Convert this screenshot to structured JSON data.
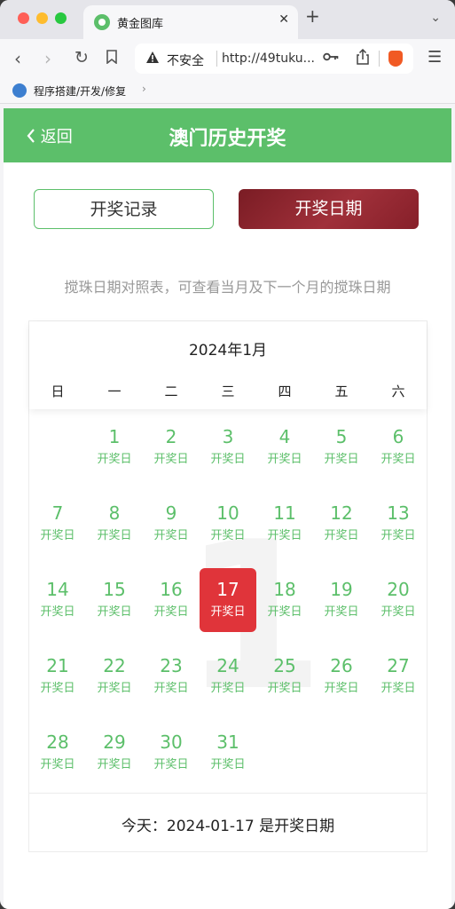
{
  "browser": {
    "tab_title": "黄金图库",
    "close_glyph": "✕",
    "new_tab_glyph": "+",
    "menu_glyph": "⌄",
    "security_label": "不安全",
    "url": "http://49tuku...",
    "bookmark_label": "程序搭建/开发/修复"
  },
  "header": {
    "back_label": "返回",
    "title": "澳门历史开奖"
  },
  "buttons": {
    "records": "开奖记录",
    "dates": "开奖日期"
  },
  "description": "搅珠日期对照表，可查看当月及下一个月的搅珠日期",
  "calendar": {
    "month_label": "2024年1月",
    "watermark": "1",
    "weekdays": [
      "日",
      "一",
      "二",
      "三",
      "四",
      "五",
      "六"
    ],
    "first_weekday": 1,
    "days": [
      {
        "num": "1",
        "label": "开奖日"
      },
      {
        "num": "2",
        "label": "开奖日"
      },
      {
        "num": "3",
        "label": "开奖日"
      },
      {
        "num": "4",
        "label": "开奖日"
      },
      {
        "num": "5",
        "label": "开奖日"
      },
      {
        "num": "6",
        "label": "开奖日"
      },
      {
        "num": "7",
        "label": "开奖日"
      },
      {
        "num": "8",
        "label": "开奖日"
      },
      {
        "num": "9",
        "label": "开奖日"
      },
      {
        "num": "10",
        "label": "开奖日"
      },
      {
        "num": "11",
        "label": "开奖日"
      },
      {
        "num": "12",
        "label": "开奖日"
      },
      {
        "num": "13",
        "label": "开奖日"
      },
      {
        "num": "14",
        "label": "开奖日"
      },
      {
        "num": "15",
        "label": "开奖日"
      },
      {
        "num": "16",
        "label": "开奖日"
      },
      {
        "num": "17",
        "label": "开奖日"
      },
      {
        "num": "18",
        "label": "开奖日"
      },
      {
        "num": "19",
        "label": "开奖日"
      },
      {
        "num": "20",
        "label": "开奖日"
      },
      {
        "num": "21",
        "label": "开奖日"
      },
      {
        "num": "22",
        "label": "开奖日"
      },
      {
        "num": "23",
        "label": "开奖日"
      },
      {
        "num": "24",
        "label": "开奖日"
      },
      {
        "num": "25",
        "label": "开奖日"
      },
      {
        "num": "26",
        "label": "开奖日"
      },
      {
        "num": "27",
        "label": "开奖日"
      },
      {
        "num": "28",
        "label": "开奖日"
      },
      {
        "num": "29",
        "label": "开奖日"
      },
      {
        "num": "30",
        "label": "开奖日"
      },
      {
        "num": "31",
        "label": "开奖日"
      }
    ],
    "today_day": "17",
    "today_text": "今天：2024-01-17 是开奖日期"
  },
  "colors": {
    "brand_green": "#5cbf6a",
    "active_button": "#8a2430",
    "today_red": "#e0343a"
  },
  "icons": [
    "back-chevron-icon",
    "warning-icon",
    "key-icon",
    "share-icon",
    "brave-lion-icon",
    "hamburger-menu-icon"
  ]
}
